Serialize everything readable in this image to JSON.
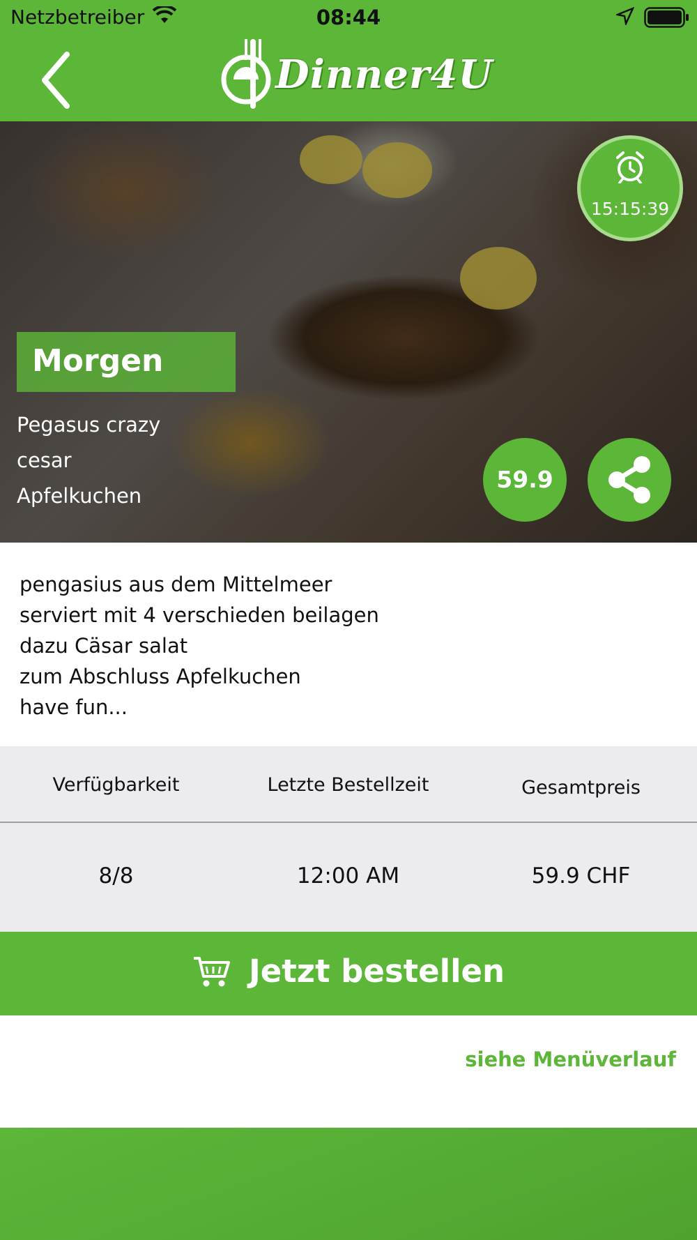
{
  "status_bar": {
    "carrier": "Netzbetreiber",
    "time": "08:44"
  },
  "header": {
    "logo_text": "Dinner4U",
    "back_icon": "chevron-left-icon"
  },
  "hero": {
    "timer": "15:15:39",
    "timer_icon": "alarm-clock-icon",
    "category": "Morgen",
    "dishes": [
      "Pegasus crazy",
      "cesar",
      "Apfelkuchen"
    ],
    "price": "59.9",
    "share_icon": "share-icon"
  },
  "description": [
    "pengasius aus dem Mittelmeer",
    "serviert mit 4 verschieden beilagen",
    "dazu Cäsar salat",
    "zum Abschluss Apfelkuchen",
    "have fun..."
  ],
  "info_table": {
    "headers": [
      "Verfügbarkeit",
      "Letzte Bestellzeit",
      "Gesamtpreis"
    ],
    "values": [
      "8/8",
      "12:00 AM",
      "59.9 CHF"
    ]
  },
  "order_button": {
    "label": "Jetzt bestellen",
    "icon": "cart-icon"
  },
  "history_link": "siehe Menüverlauf",
  "colors": {
    "brand_green": "#5cb638",
    "table_bg": "#ebebf0"
  }
}
